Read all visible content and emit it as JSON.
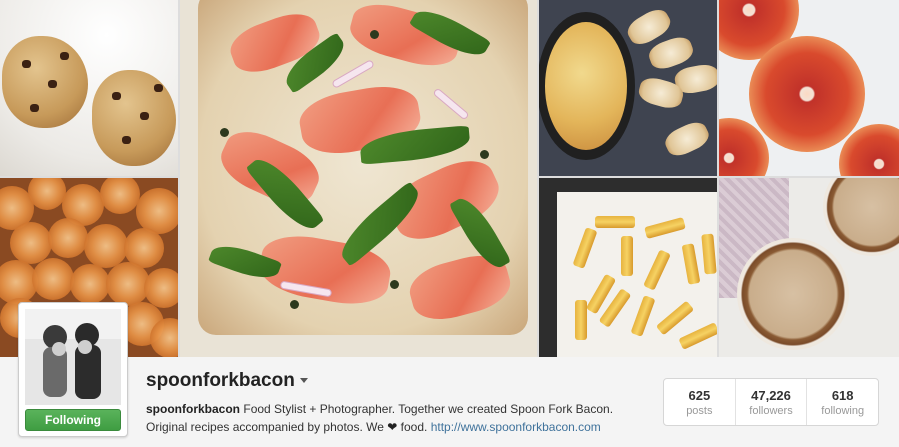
{
  "profile": {
    "username": "spoonforkbacon",
    "bio_name": "spoonforkbacon",
    "bio_text_1": "Food Stylist + Photographer. Together we created Spoon Fork Bacon.",
    "bio_text_2": "Original recipes accompanied by photos. We",
    "heart": "❤",
    "bio_text_3": "food.",
    "website": "http://www.spoonforkbacon.com",
    "follow_label": "Following"
  },
  "stats": [
    {
      "value": "625",
      "label": "posts"
    },
    {
      "value": "47,226",
      "label": "followers"
    },
    {
      "value": "618",
      "label": "following"
    }
  ],
  "colors": {
    "follow_green": "#4caf50",
    "link_blue": "#3f729b"
  },
  "icons": {
    "dropdown": "chevron-down-icon"
  }
}
